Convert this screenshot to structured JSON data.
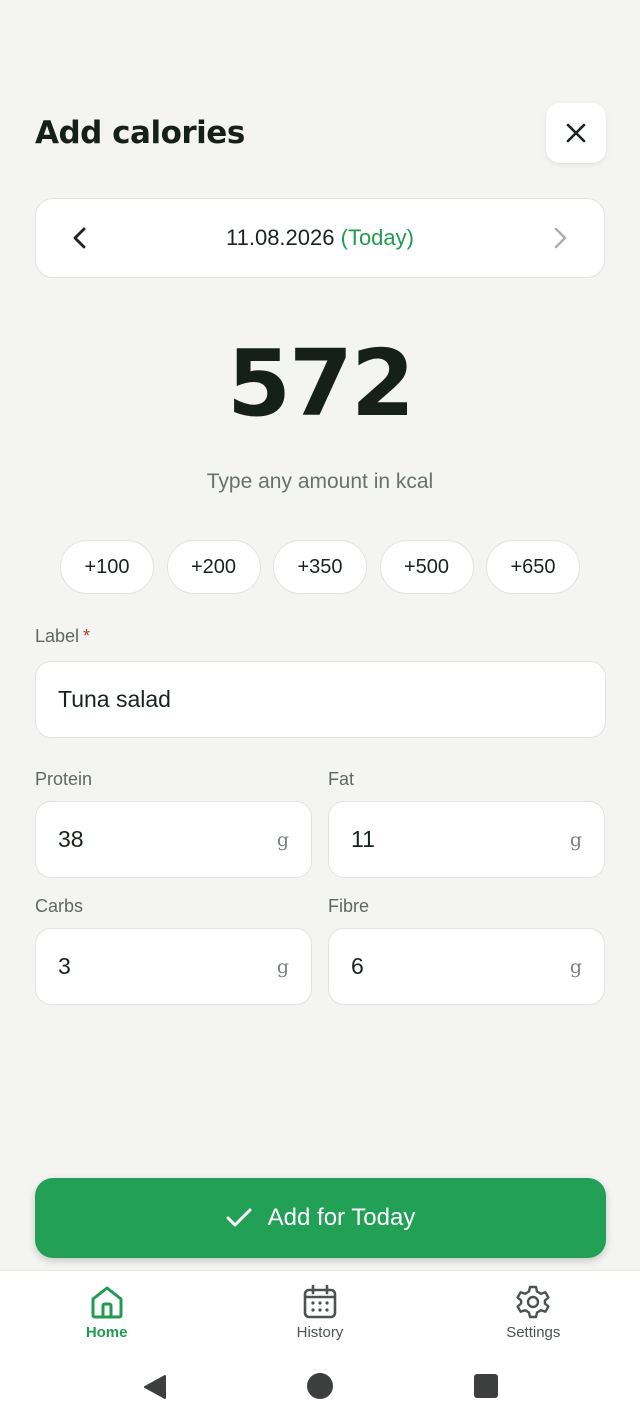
{
  "header": {
    "title": "Add calories",
    "close_icon": "close-icon"
  },
  "date_bar": {
    "date": "11.08.2026",
    "today_label": "(Today)"
  },
  "calories": {
    "value": "572",
    "hint": "Type any amount in kcal"
  },
  "quick_add": [
    "+100",
    "+200",
    "+350",
    "+500",
    "+650"
  ],
  "label_field": {
    "label": "Label",
    "required_mark": "*",
    "value": "Tuna salad"
  },
  "macros": {
    "protein": {
      "label": "Protein",
      "value": "38",
      "unit": "g"
    },
    "fat": {
      "label": "Fat",
      "value": "11",
      "unit": "g"
    },
    "carbs": {
      "label": "Carbs",
      "value": "3",
      "unit": "g"
    },
    "fibre": {
      "label": "Fibre",
      "value": "6",
      "unit": "g"
    }
  },
  "submit": {
    "label": "Add for Today"
  },
  "bottom_nav": {
    "items": [
      {
        "label": "Home",
        "icon": "home-icon",
        "active": true
      },
      {
        "label": "History",
        "icon": "calendar-icon",
        "active": false
      },
      {
        "label": "Settings",
        "icon": "gear-icon",
        "active": false
      }
    ]
  },
  "colors": {
    "accent": "#21a056",
    "today_text": "#219a52",
    "background": "#f4f5f2"
  }
}
